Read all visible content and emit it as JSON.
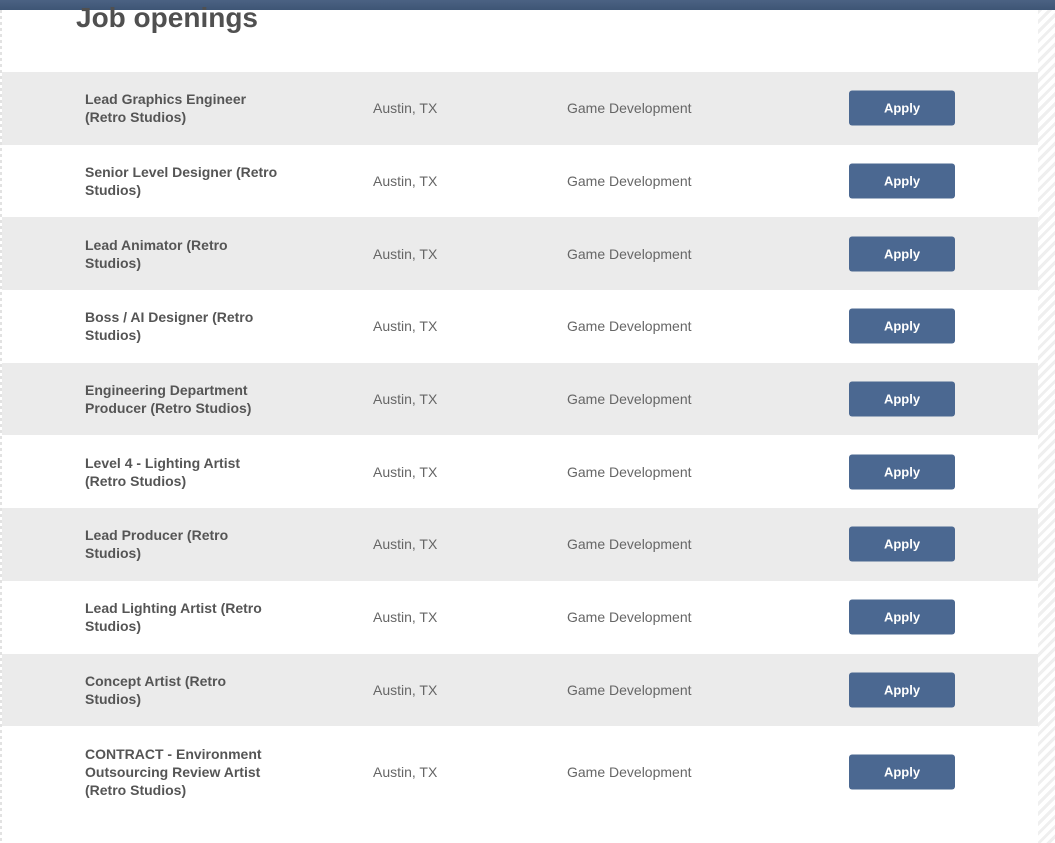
{
  "page": {
    "title": "Job openings",
    "colors": {
      "header_bar": "#4b6283",
      "row_alt": "#ebebeb",
      "button": "#4b6891",
      "button_text": "#ffffff"
    }
  },
  "jobs": [
    {
      "title": "Lead Graphics Engineer (Retro Studios)",
      "location": "Austin, TX",
      "department": "Game Development",
      "apply_label": "Apply"
    },
    {
      "title": "Senior Level Designer (Retro Studios)",
      "location": "Austin, TX",
      "department": "Game Development",
      "apply_label": "Apply"
    },
    {
      "title": "Lead Animator (Retro Studios)",
      "location": "Austin, TX",
      "department": "Game Development",
      "apply_label": "Apply"
    },
    {
      "title": "Boss / AI Designer (Retro Studios)",
      "location": "Austin, TX",
      "department": "Game Development",
      "apply_label": "Apply"
    },
    {
      "title": "Engineering Department Producer (Retro Studios)",
      "location": "Austin, TX",
      "department": "Game Development",
      "apply_label": "Apply"
    },
    {
      "title": "Level 4 - Lighting Artist (Retro Studios)",
      "location": "Austin, TX",
      "department": "Game Development",
      "apply_label": "Apply"
    },
    {
      "title": "Lead Producer (Retro Studios)",
      "location": "Austin, TX",
      "department": "Game Development",
      "apply_label": "Apply"
    },
    {
      "title": "Lead Lighting Artist (Retro Studios)",
      "location": "Austin, TX",
      "department": "Game Development",
      "apply_label": "Apply"
    },
    {
      "title": "Concept Artist (Retro Studios)",
      "location": "Austin, TX",
      "department": "Game Development",
      "apply_label": "Apply"
    },
    {
      "title": "CONTRACT - Environment Outsourcing Review Artist (Retro Studios)",
      "location": "Austin, TX",
      "department": "Game Development",
      "apply_label": "Apply"
    }
  ]
}
